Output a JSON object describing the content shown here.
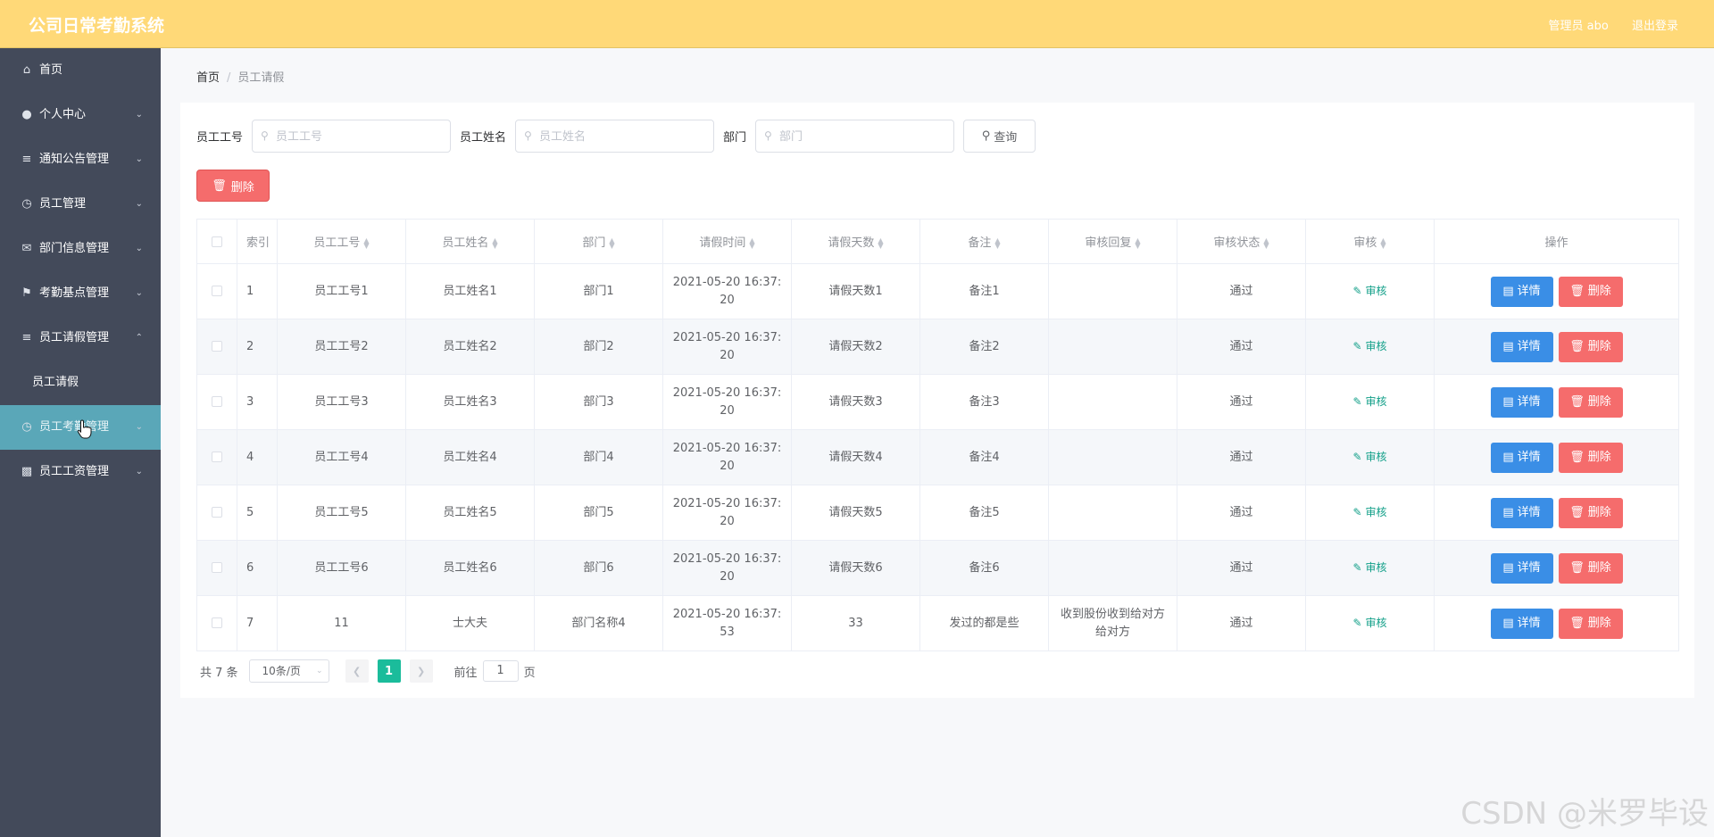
{
  "app": {
    "title": "公司日常考勤系统",
    "user_label": "管理员 abo",
    "logout_label": "退出登录"
  },
  "sidebar": {
    "items": [
      {
        "label": "首页",
        "icon": "home-icon"
      },
      {
        "label": "个人中心",
        "icon": "user-icon"
      },
      {
        "label": "通知公告管理",
        "icon": "list-icon"
      },
      {
        "label": "员工管理",
        "icon": "clock-icon"
      },
      {
        "label": "部门信息管理",
        "icon": "mail-icon"
      },
      {
        "label": "考勤基点管理",
        "icon": "flag-icon"
      },
      {
        "label": "员工请假管理",
        "icon": "sliders-icon"
      },
      {
        "label": "员工考勤管理",
        "icon": "clock-icon"
      },
      {
        "label": "员工工资管理",
        "icon": "card-icon"
      }
    ],
    "submenu": {
      "label": "员工请假"
    },
    "active_index": 7
  },
  "breadcrumb": {
    "home": "首页",
    "current": "员工请假"
  },
  "search": {
    "emp_no_label": "员工工号",
    "emp_no_placeholder": "员工工号",
    "emp_name_label": "员工姓名",
    "emp_name_placeholder": "员工姓名",
    "dept_label": "部门",
    "dept_placeholder": "部门",
    "query_label": "查询"
  },
  "toolbar": {
    "delete_label": "删除"
  },
  "table": {
    "headers": [
      "索引",
      "员工工号",
      "员工姓名",
      "部门",
      "请假时间",
      "请假天数",
      "备注",
      "审核回复",
      "审核状态",
      "审核",
      "操作"
    ],
    "audit_label": "审核",
    "detail_label": "详情",
    "delete_label": "删除",
    "rows": [
      {
        "idx": "1",
        "emp_no": "员工工号1",
        "emp_name": "员工姓名1",
        "dept": "部门1",
        "time_a": "2021-05-20 16:37:",
        "time_b": "20",
        "days": "请假天数1",
        "note": "备注1",
        "reply": "",
        "status": "通过"
      },
      {
        "idx": "2",
        "emp_no": "员工工号2",
        "emp_name": "员工姓名2",
        "dept": "部门2",
        "time_a": "2021-05-20 16:37:",
        "time_b": "20",
        "days": "请假天数2",
        "note": "备注2",
        "reply": "",
        "status": "通过"
      },
      {
        "idx": "3",
        "emp_no": "员工工号3",
        "emp_name": "员工姓名3",
        "dept": "部门3",
        "time_a": "2021-05-20 16:37:",
        "time_b": "20",
        "days": "请假天数3",
        "note": "备注3",
        "reply": "",
        "status": "通过"
      },
      {
        "idx": "4",
        "emp_no": "员工工号4",
        "emp_name": "员工姓名4",
        "dept": "部门4",
        "time_a": "2021-05-20 16:37:",
        "time_b": "20",
        "days": "请假天数4",
        "note": "备注4",
        "reply": "",
        "status": "通过"
      },
      {
        "idx": "5",
        "emp_no": "员工工号5",
        "emp_name": "员工姓名5",
        "dept": "部门5",
        "time_a": "2021-05-20 16:37:",
        "time_b": "20",
        "days": "请假天数5",
        "note": "备注5",
        "reply": "",
        "status": "通过"
      },
      {
        "idx": "6",
        "emp_no": "员工工号6",
        "emp_name": "员工姓名6",
        "dept": "部门6",
        "time_a": "2021-05-20 16:37:",
        "time_b": "20",
        "days": "请假天数6",
        "note": "备注6",
        "reply": "",
        "status": "通过"
      },
      {
        "idx": "7",
        "emp_no": "11",
        "emp_name": "士大夫",
        "dept": "部门名称4",
        "time_a": "2021-05-20 16:37:",
        "time_b": "53",
        "days": "33",
        "note": "发过的都是些",
        "reply": "收到股份收到给对方给对方",
        "status": "通过"
      }
    ]
  },
  "pagination": {
    "total": "共 7 条",
    "page_size": "10条/页",
    "current_page": "1",
    "goto_label": "前往",
    "goto_value": "1",
    "page_suffix": "页"
  },
  "watermark": "CSDN @米罗毕设"
}
